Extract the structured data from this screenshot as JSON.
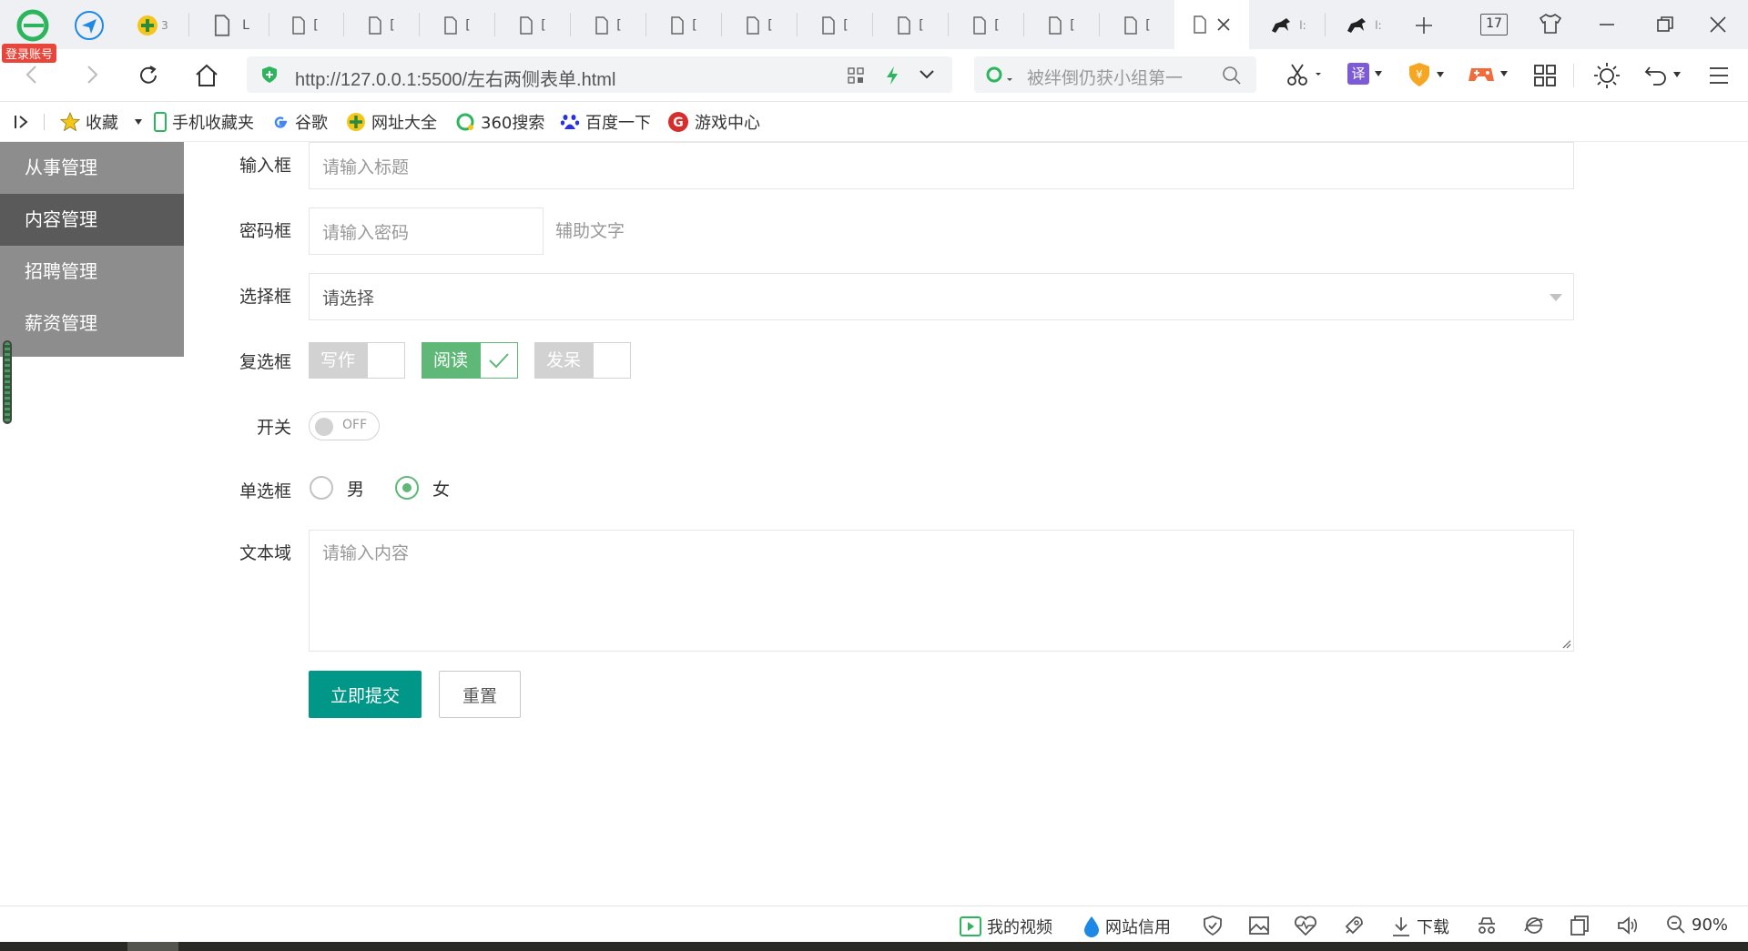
{
  "browser": {
    "login_badge": "登录账号",
    "pinned_tab_1_text": "3",
    "doc_tabs_label": "[",
    "doc_tab_first_label": "L",
    "app_tab_label": "l:",
    "tab_count": "17",
    "url": "http://127.0.0.1:5500/左右两侧表单.html",
    "search_placeholder": "被绊倒仍获小组第一",
    "translate_label": "译"
  },
  "bookmarks": [
    {
      "label": "收藏",
      "icon": "star-icon"
    },
    {
      "label": "手机收藏夹",
      "icon": "phone-icon"
    },
    {
      "label": "谷歌",
      "icon": "google-icon"
    },
    {
      "label": "网址大全",
      "icon": "nav-icon"
    },
    {
      "label": "360搜索",
      "icon": "360-icon"
    },
    {
      "label": "百度一下",
      "icon": "baidu-icon"
    },
    {
      "label": "游戏中心",
      "icon": "game-icon"
    }
  ],
  "sidebar": {
    "items": [
      {
        "label": "从事管理"
      },
      {
        "label": "内容管理"
      },
      {
        "label": "招聘管理"
      },
      {
        "label": "薪资管理"
      }
    ]
  },
  "form": {
    "input_label": "输入框",
    "input_placeholder": "请输入标题",
    "password_label": "密码框",
    "password_placeholder": "请输入密码",
    "password_aux": "辅助文字",
    "select_label": "选择框",
    "select_placeholder": "请选择",
    "checkbox_label": "复选框",
    "checkboxes": [
      {
        "label": "写作",
        "checked": false
      },
      {
        "label": "阅读",
        "checked": true
      },
      {
        "label": "发呆",
        "checked": false
      }
    ],
    "switch_label": "开关",
    "switch_text": "OFF",
    "radio_label": "单选框",
    "radios": [
      {
        "label": "男",
        "checked": false
      },
      {
        "label": "女",
        "checked": true
      }
    ],
    "textarea_label": "文本域",
    "textarea_placeholder": "请输入内容",
    "submit_label": "立即提交",
    "reset_label": "重置"
  },
  "statusbar": {
    "video": "我的视频",
    "credit": "网站信用",
    "download": "下载",
    "zoom": "90%"
  },
  "colors": {
    "primary": "#009688",
    "checked": "#5fb878",
    "sidebar": "#8e8d8d",
    "sidebar_active": "#5a5a5a"
  }
}
